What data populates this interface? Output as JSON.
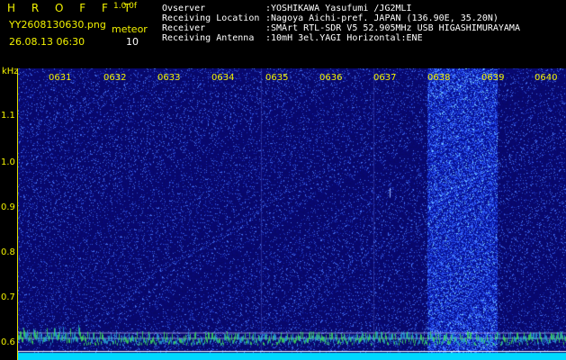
{
  "header": {
    "title": "H R O F F T",
    "version": "1.0.0f",
    "filename": "YY2608130630.png",
    "meteor_label": "meteor",
    "datetime": "26.08.13 06:30",
    "meteor_count": "10"
  },
  "info": [
    {
      "label": "Ovserver",
      "value": ":YOSHIKAWA Yasufumi /JG2MLI"
    },
    {
      "label": "Receiving Location",
      "value": ":Nagoya Aichi-pref. JAPAN (136.90E, 35.20N)"
    },
    {
      "label": "Receiver",
      "value": ":SMArt RTL-SDR V5 52.905MHz USB HIGASHIMURAYAMA"
    },
    {
      "label": "Receiving Antenna",
      "value": ":10mH 3el.YAGI Horizontal:ENE"
    }
  ],
  "axes": {
    "y_unit": "kHz",
    "y_ticks": [
      "1.1",
      "1.0",
      "0.9",
      "0.8",
      "0.7",
      "0.6"
    ],
    "x_ticks": [
      "0631",
      "0632",
      "0633",
      "0634",
      "0635",
      "0636",
      "0637",
      "0638",
      "0639",
      "0640"
    ]
  },
  "colors": {
    "text_yellow": "#f2f200",
    "text_white": "#ffffff",
    "spectrogram_bg": "#0a0a6e",
    "noise_band": "#2a3cc8",
    "baseline_cyan": "#00d8ff"
  }
}
